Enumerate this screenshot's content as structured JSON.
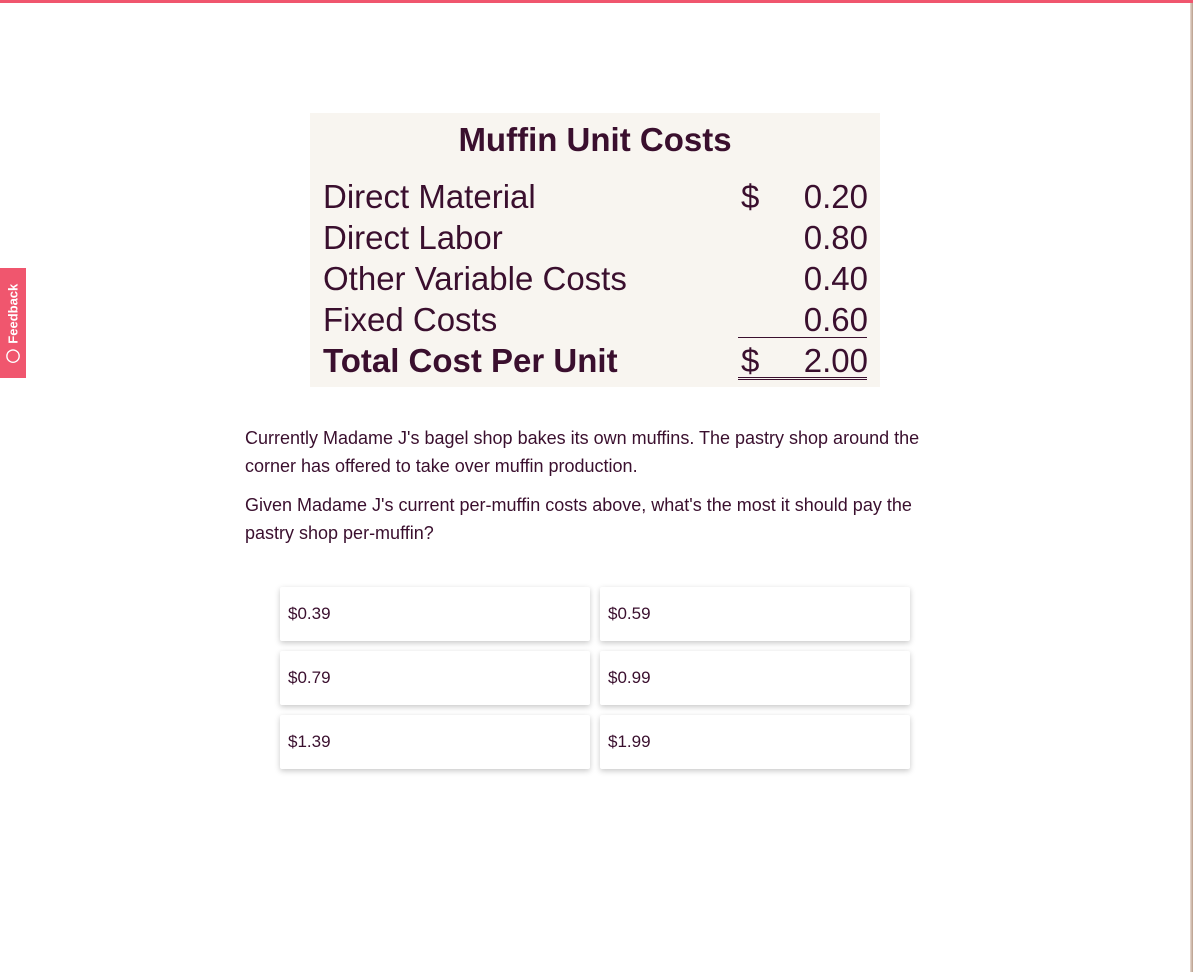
{
  "feedback": {
    "label": "Feedback",
    "icon": "speech-bubble-icon",
    "color": "#f0566e"
  },
  "cost_table": {
    "title": "Muffin Unit Costs",
    "currency_symbol": "$",
    "rows": [
      {
        "label": "Direct Material",
        "value": "0.20"
      },
      {
        "label": "Direct Labor",
        "value": "0.80"
      },
      {
        "label": "Other Variable Costs",
        "value": "0.40"
      },
      {
        "label": "Fixed Costs",
        "value": "0.60"
      }
    ],
    "total": {
      "label": "Total Cost Per Unit",
      "value": "2.00"
    }
  },
  "question": {
    "paragraph1": "Currently Madame J's bagel shop bakes its own muffins. The pastry shop around the corner has offered to take over muffin production.",
    "paragraph2": "Given Madame J's current per-muffin costs above, what's the most it should pay the pastry shop per-muffin?"
  },
  "options": [
    "$0.39",
    "$0.59",
    "$0.79",
    "$0.99",
    "$1.39",
    "$1.99"
  ],
  "colors": {
    "accent": "#f0566e",
    "text": "#3a0f2e",
    "card_bg": "#f8f5f0"
  }
}
